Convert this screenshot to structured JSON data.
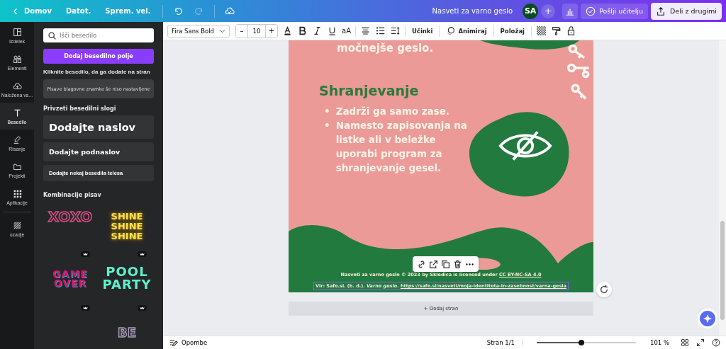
{
  "topbar": {
    "back": "Domov",
    "menus": [
      "Datot.",
      "Sprem. vel."
    ],
    "redo_disabled": true,
    "doc_title": "Nasveti za varno geslo",
    "avatar": "SA",
    "add": "+",
    "submit": "Pošlji učitelju",
    "share": "Deli z drugimi"
  },
  "rail": [
    {
      "label": "Izdelek",
      "kind": "layout",
      "selected": false
    },
    {
      "label": "Elementi",
      "kind": "shapes",
      "selected": false
    },
    {
      "label": "Naložena vs...",
      "kind": "upload",
      "selected": false
    },
    {
      "label": "Besedilo",
      "kind": "text",
      "selected": true
    },
    {
      "label": "Risanje",
      "kind": "draw",
      "selected": false
    },
    {
      "label": "Projekti",
      "kind": "folder",
      "selected": false
    },
    {
      "label": "Aplikacije",
      "kind": "apps",
      "selected": false
    },
    {
      "label": "ozadje",
      "kind": "pattern",
      "selected": false
    }
  ],
  "panel": {
    "search": {
      "placeholder": "Išči besedilo"
    },
    "add_button": "Dodaj besedilno polje",
    "hint": "Kliknite besedilo, da ga dodate na stran",
    "brand_note": "Pisave blagovne znamke še niso nastavljene",
    "styles_title": "Privzeti besedilni slogi",
    "styles": [
      {
        "kind": "heading",
        "label": "Dodajte naslov"
      },
      {
        "kind": "subheading",
        "label": "Dodajte podnaslov"
      },
      {
        "kind": "body",
        "label": "Dodajte nekaj besedila telesa"
      }
    ],
    "combos_title": "Kombinacije pisav",
    "combos": [
      {
        "kind": "xoxo",
        "lines": [
          "XOXO"
        ]
      },
      {
        "kind": "shine",
        "lines": [
          "SHINE",
          "SHINE",
          "SHINE"
        ]
      },
      {
        "kind": "game",
        "lines": [
          "GAME",
          "OVER"
        ]
      },
      {
        "kind": "pool",
        "lines": [
          "POOL",
          "PARTY"
        ]
      },
      {
        "kind": "script"
      },
      {
        "kind": "be",
        "lines": [
          "BE"
        ]
      }
    ]
  },
  "toolbar": {
    "font": "Fira Sans Bold",
    "minus": "–",
    "size": "10",
    "plus": "+",
    "case": "aA",
    "effects": "Učinki",
    "animate": "Animiraj",
    "position": "Položaj"
  },
  "page": {
    "top_line": "močnejše geslo.",
    "heading": "Shranjevanje",
    "bullet": "•",
    "bullets": [
      "Zadrži ga samo zase.",
      "Namesto zapisovanja na listke ali v beležke uporabi program za shranjevanje gesel."
    ],
    "credits": [
      {
        "text": "Nasveti za varno geslo © 2023 by Skledica is licensed under ",
        "link": "CC BY-NC-SA 4.0"
      },
      {
        "text": "Vir: Safe.si. (b. d.). *Varno geslo*. ",
        "link": "https://safe.si/nasveti/moja-identiteta-in-zasebnost/varna-gesla"
      }
    ]
  },
  "add_page": "+ Dodaj stran",
  "bottombar": {
    "notes": "Opombe",
    "page": "Stran 1/1",
    "zoom": {
      "level": 0.45
    },
    "zoom_text": "101 %"
  }
}
